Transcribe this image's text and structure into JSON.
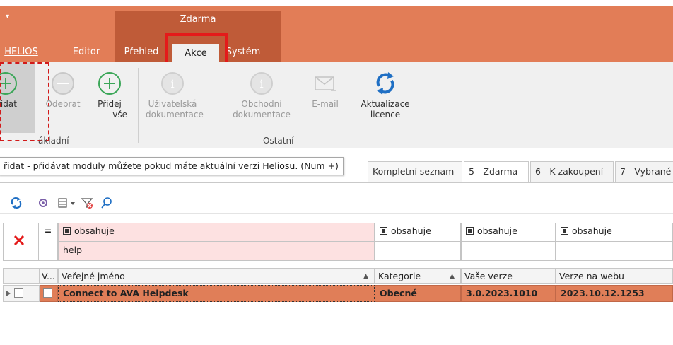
{
  "ribbon": {
    "qat_glyph": "▾",
    "context_group": "Zdarma",
    "tabs": {
      "helios": "HELIOS",
      "editor": "Editor",
      "prehled": "Přehled",
      "akce": "Akce",
      "system": "Systém"
    },
    "buttons": {
      "pridat": "řidat",
      "odebrat": "Odebrat",
      "pridej_vse_1": "Přidej",
      "pridej_vse_2": "vše",
      "uziv_1": "Uživatelská",
      "uziv_2": "dokumentace",
      "obch_1": "Obchodní",
      "obch_2": "dokumentace",
      "email": "E-mail",
      "aktual_1": "Aktualizace",
      "aktual_2": "licence"
    },
    "groups": {
      "zakladni": "ákladní",
      "ostatni": "Ostatní"
    },
    "colors": {
      "header": "#e27d57",
      "context": "#bf5b38",
      "green": "#3aa657",
      "blue": "#1f6fc4"
    }
  },
  "tooltip": "řidat - přidávat moduly můžete pokud máte aktuální verzi Heliosu. (Num +)",
  "doc_tabs": [
    "Kompletní seznam",
    "5 - Zdarma",
    "6 - K zakoupení",
    "7 - Vybrané"
  ],
  "filter": {
    "eq_symbol": "=",
    "col1_op": "obsahuje",
    "col1_value": "help",
    "col2_op": "obsahuje",
    "col3_op": "obsahuje",
    "col4_op": "obsahuje"
  },
  "grid": {
    "headers": {
      "v": "V...",
      "name": "Veřejné jméno",
      "category": "Kategorie",
      "your_version": "Vaše verze",
      "web_version": "Verze na webu"
    },
    "rows": [
      {
        "name": "Connect to AVA Helpdesk",
        "category": "Obecné",
        "your_version": "3.0.2023.1010",
        "web_version": "2023.10.12.1253"
      }
    ]
  }
}
